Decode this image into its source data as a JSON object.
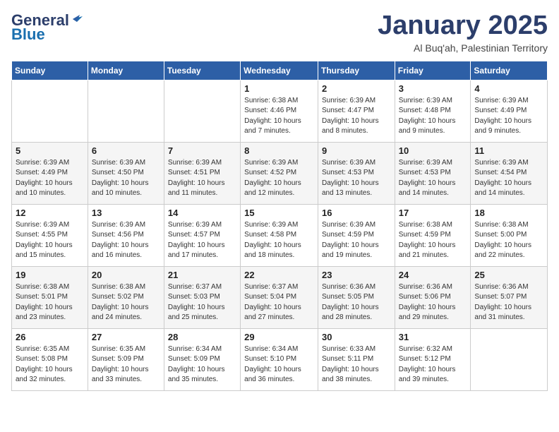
{
  "logo": {
    "line1": "General",
    "line2": "Blue"
  },
  "title": "January 2025",
  "subtitle": "Al Buq'ah, Palestinian Territory",
  "days_header": [
    "Sunday",
    "Monday",
    "Tuesday",
    "Wednesday",
    "Thursday",
    "Friday",
    "Saturday"
  ],
  "weeks": [
    [
      {
        "day": "",
        "info": ""
      },
      {
        "day": "",
        "info": ""
      },
      {
        "day": "",
        "info": ""
      },
      {
        "day": "1",
        "info": "Sunrise: 6:38 AM\nSunset: 4:46 PM\nDaylight: 10 hours\nand 7 minutes."
      },
      {
        "day": "2",
        "info": "Sunrise: 6:39 AM\nSunset: 4:47 PM\nDaylight: 10 hours\nand 8 minutes."
      },
      {
        "day": "3",
        "info": "Sunrise: 6:39 AM\nSunset: 4:48 PM\nDaylight: 10 hours\nand 9 minutes."
      },
      {
        "day": "4",
        "info": "Sunrise: 6:39 AM\nSunset: 4:49 PM\nDaylight: 10 hours\nand 9 minutes."
      }
    ],
    [
      {
        "day": "5",
        "info": "Sunrise: 6:39 AM\nSunset: 4:49 PM\nDaylight: 10 hours\nand 10 minutes."
      },
      {
        "day": "6",
        "info": "Sunrise: 6:39 AM\nSunset: 4:50 PM\nDaylight: 10 hours\nand 10 minutes."
      },
      {
        "day": "7",
        "info": "Sunrise: 6:39 AM\nSunset: 4:51 PM\nDaylight: 10 hours\nand 11 minutes."
      },
      {
        "day": "8",
        "info": "Sunrise: 6:39 AM\nSunset: 4:52 PM\nDaylight: 10 hours\nand 12 minutes."
      },
      {
        "day": "9",
        "info": "Sunrise: 6:39 AM\nSunset: 4:53 PM\nDaylight: 10 hours\nand 13 minutes."
      },
      {
        "day": "10",
        "info": "Sunrise: 6:39 AM\nSunset: 4:53 PM\nDaylight: 10 hours\nand 14 minutes."
      },
      {
        "day": "11",
        "info": "Sunrise: 6:39 AM\nSunset: 4:54 PM\nDaylight: 10 hours\nand 14 minutes."
      }
    ],
    [
      {
        "day": "12",
        "info": "Sunrise: 6:39 AM\nSunset: 4:55 PM\nDaylight: 10 hours\nand 15 minutes."
      },
      {
        "day": "13",
        "info": "Sunrise: 6:39 AM\nSunset: 4:56 PM\nDaylight: 10 hours\nand 16 minutes."
      },
      {
        "day": "14",
        "info": "Sunrise: 6:39 AM\nSunset: 4:57 PM\nDaylight: 10 hours\nand 17 minutes."
      },
      {
        "day": "15",
        "info": "Sunrise: 6:39 AM\nSunset: 4:58 PM\nDaylight: 10 hours\nand 18 minutes."
      },
      {
        "day": "16",
        "info": "Sunrise: 6:39 AM\nSunset: 4:59 PM\nDaylight: 10 hours\nand 19 minutes."
      },
      {
        "day": "17",
        "info": "Sunrise: 6:38 AM\nSunset: 4:59 PM\nDaylight: 10 hours\nand 21 minutes."
      },
      {
        "day": "18",
        "info": "Sunrise: 6:38 AM\nSunset: 5:00 PM\nDaylight: 10 hours\nand 22 minutes."
      }
    ],
    [
      {
        "day": "19",
        "info": "Sunrise: 6:38 AM\nSunset: 5:01 PM\nDaylight: 10 hours\nand 23 minutes."
      },
      {
        "day": "20",
        "info": "Sunrise: 6:38 AM\nSunset: 5:02 PM\nDaylight: 10 hours\nand 24 minutes."
      },
      {
        "day": "21",
        "info": "Sunrise: 6:37 AM\nSunset: 5:03 PM\nDaylight: 10 hours\nand 25 minutes."
      },
      {
        "day": "22",
        "info": "Sunrise: 6:37 AM\nSunset: 5:04 PM\nDaylight: 10 hours\nand 27 minutes."
      },
      {
        "day": "23",
        "info": "Sunrise: 6:36 AM\nSunset: 5:05 PM\nDaylight: 10 hours\nand 28 minutes."
      },
      {
        "day": "24",
        "info": "Sunrise: 6:36 AM\nSunset: 5:06 PM\nDaylight: 10 hours\nand 29 minutes."
      },
      {
        "day": "25",
        "info": "Sunrise: 6:36 AM\nSunset: 5:07 PM\nDaylight: 10 hours\nand 31 minutes."
      }
    ],
    [
      {
        "day": "26",
        "info": "Sunrise: 6:35 AM\nSunset: 5:08 PM\nDaylight: 10 hours\nand 32 minutes."
      },
      {
        "day": "27",
        "info": "Sunrise: 6:35 AM\nSunset: 5:09 PM\nDaylight: 10 hours\nand 33 minutes."
      },
      {
        "day": "28",
        "info": "Sunrise: 6:34 AM\nSunset: 5:09 PM\nDaylight: 10 hours\nand 35 minutes."
      },
      {
        "day": "29",
        "info": "Sunrise: 6:34 AM\nSunset: 5:10 PM\nDaylight: 10 hours\nand 36 minutes."
      },
      {
        "day": "30",
        "info": "Sunrise: 6:33 AM\nSunset: 5:11 PM\nDaylight: 10 hours\nand 38 minutes."
      },
      {
        "day": "31",
        "info": "Sunrise: 6:32 AM\nSunset: 5:12 PM\nDaylight: 10 hours\nand 39 minutes."
      },
      {
        "day": "",
        "info": ""
      }
    ]
  ]
}
